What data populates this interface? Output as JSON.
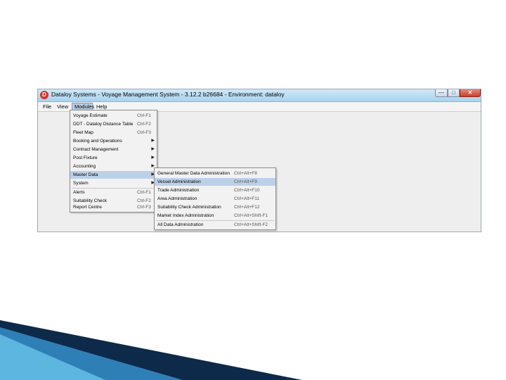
{
  "window": {
    "title": "Dataloy Systems - Voyage Management System - 3.12.2 b26684 - Environment: dataloy",
    "app_icon_glyph": "D",
    "buttons": {
      "minimize": "—",
      "maximize": "□",
      "close": "✕"
    }
  },
  "menubar": {
    "items": [
      "File",
      "View",
      "Modules",
      "Help"
    ],
    "active": "Modules"
  },
  "modules_menu": {
    "items": [
      {
        "label": "Voyage Estimate",
        "shortcut": "Ctrl-F1"
      },
      {
        "label": "DDT - Dataloy Distance Table",
        "shortcut": "Ctrl-F2"
      },
      {
        "label": "Fleet Map",
        "shortcut": "Ctrl-F3"
      },
      {
        "label": "Booking and Operations",
        "submenu": true
      },
      {
        "label": "Contract Management",
        "submenu": true
      },
      {
        "label": "Post Fixture",
        "submenu": true
      },
      {
        "label": "Accounting",
        "submenu": true
      },
      {
        "label": "Master Data",
        "submenu": true,
        "selected": true
      },
      {
        "label": "System",
        "submenu": true
      },
      {
        "label": "Alerts",
        "shortcut": "Ctrl-F1"
      },
      {
        "label": "Suitability Check",
        "shortcut": "Ctrl-F2"
      },
      {
        "label": "Report Centre",
        "shortcut": "Ctrl-F3"
      }
    ]
  },
  "master_data_menu": {
    "items": [
      {
        "label": "General Master Data Administration",
        "shortcut": "Ctrl+Alt+F8"
      },
      {
        "label": "Vessel Administration",
        "shortcut": "Ctrl+Alt+F9",
        "selected": true
      },
      {
        "label": "Trade Administration",
        "shortcut": "Ctrl+Alt+F10"
      },
      {
        "label": "Area Administration",
        "shortcut": "Ctrl+Alt+F11"
      },
      {
        "label": "Suitability Check Administration",
        "shortcut": "Ctrl+Alt+F12"
      },
      {
        "label": "Market Index Administration",
        "shortcut": "Ctrl+Alt+Shift-F1"
      },
      {
        "label": "All Data Administration",
        "shortcut": "Ctrl+Alt+Shift-F2"
      }
    ]
  },
  "colors": {
    "titlebar": "#a9d3ef",
    "selection": "#bcd0e8",
    "swoosh_dark": "#0d2a4a",
    "swoosh_light": "#5cb6e0"
  }
}
